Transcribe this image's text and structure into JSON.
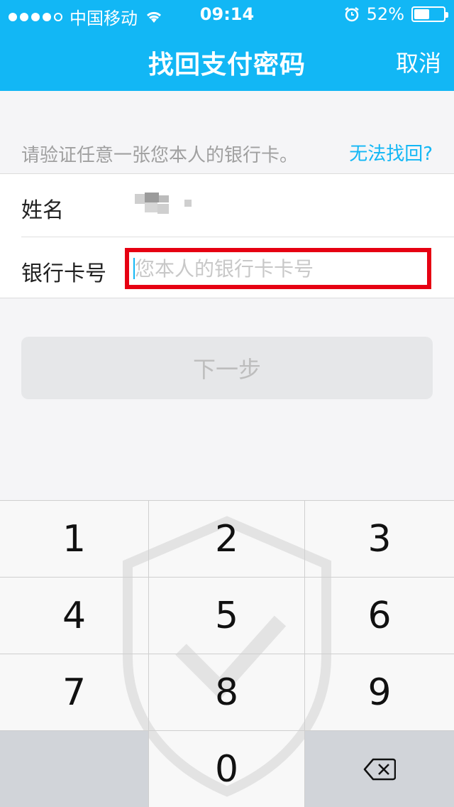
{
  "status": {
    "carrier": "中国移动",
    "time": "09:14",
    "battery": "52%",
    "battery_level": 0.52
  },
  "nav": {
    "title": "找回支付密码",
    "cancel": "取消"
  },
  "hint": {
    "text": "请验证任意一张您本人的银行卡。",
    "link": "无法找回?"
  },
  "form": {
    "name_label": "姓名",
    "card_label": "银行卡号",
    "card_placeholder": "您本人的银行卡卡号"
  },
  "next_button": "下一步",
  "keypad": {
    "keys": [
      "1",
      "2",
      "3",
      "4",
      "5",
      "6",
      "7",
      "8",
      "9",
      "",
      "0",
      "backspace-icon"
    ]
  }
}
